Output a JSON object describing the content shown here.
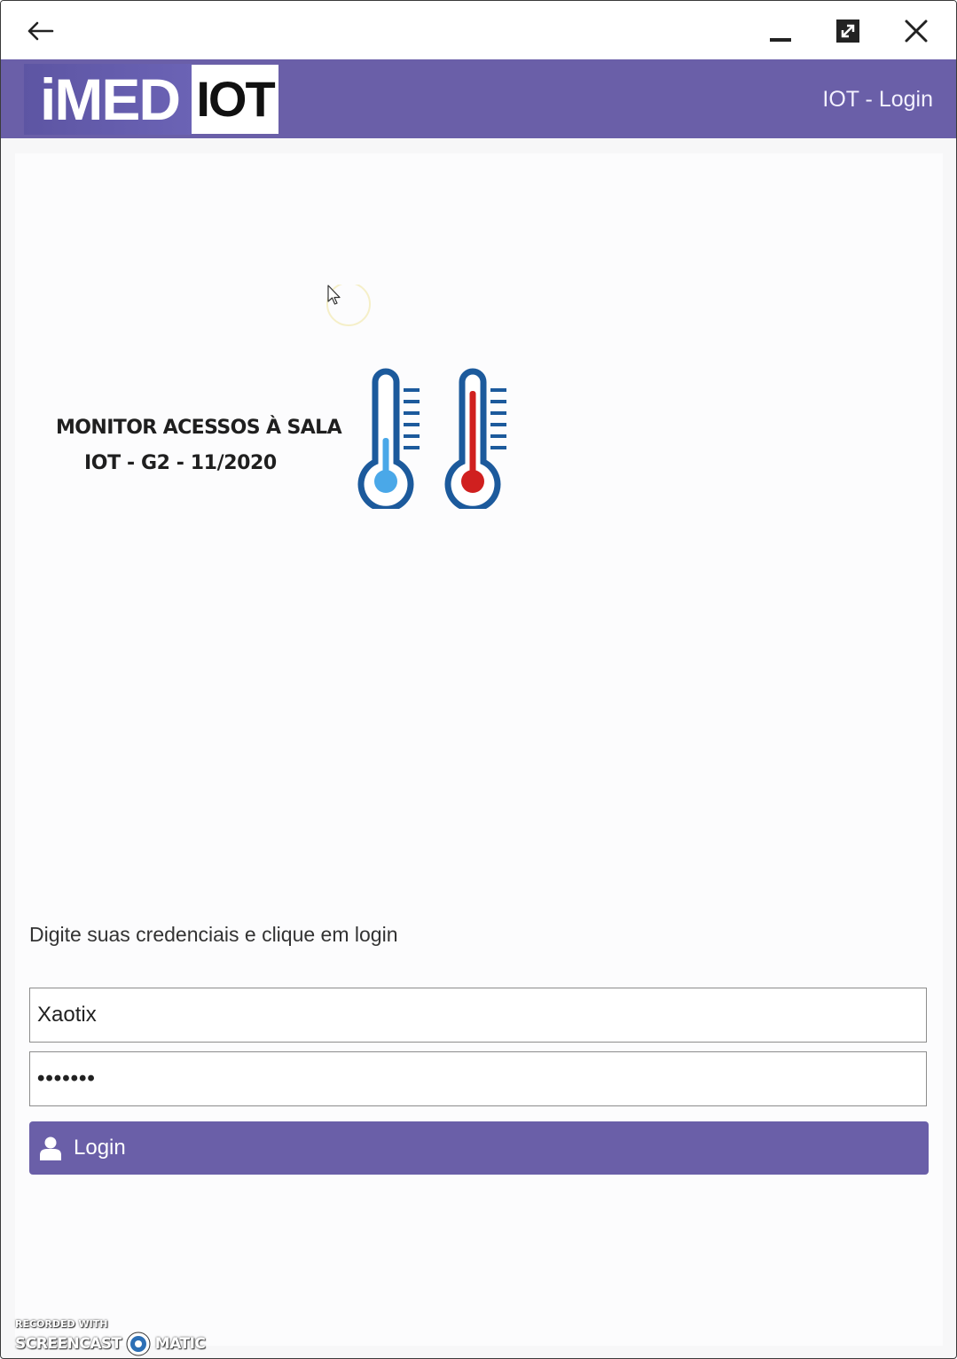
{
  "titlebar": {
    "back_icon": "arrow-left-icon",
    "minimize_icon": "minimize-icon",
    "maximize_icon": "maximize-icon",
    "close_icon": "close-icon"
  },
  "header": {
    "logo_part1": "iMED",
    "logo_part2": "IOT",
    "title": "IOT - Login",
    "background_color": "#6a5fa8"
  },
  "banner": {
    "line1": "MONITOR ACESSOS À SALA",
    "line2": "IOT - G2 - 11/2020",
    "icons": [
      "thermometer-cold-icon",
      "thermometer-hot-icon"
    ]
  },
  "form": {
    "instruction": "Digite suas credenciais e clique em login",
    "username_value": "Xaotix",
    "password_value": "•••••••",
    "login_label": "Login",
    "login_icon": "user-icon",
    "button_color": "#6a5fa8"
  },
  "watermark": {
    "line1": "RECORDED WITH",
    "part1": "SCREENCAST",
    "part2": "MATIC"
  }
}
